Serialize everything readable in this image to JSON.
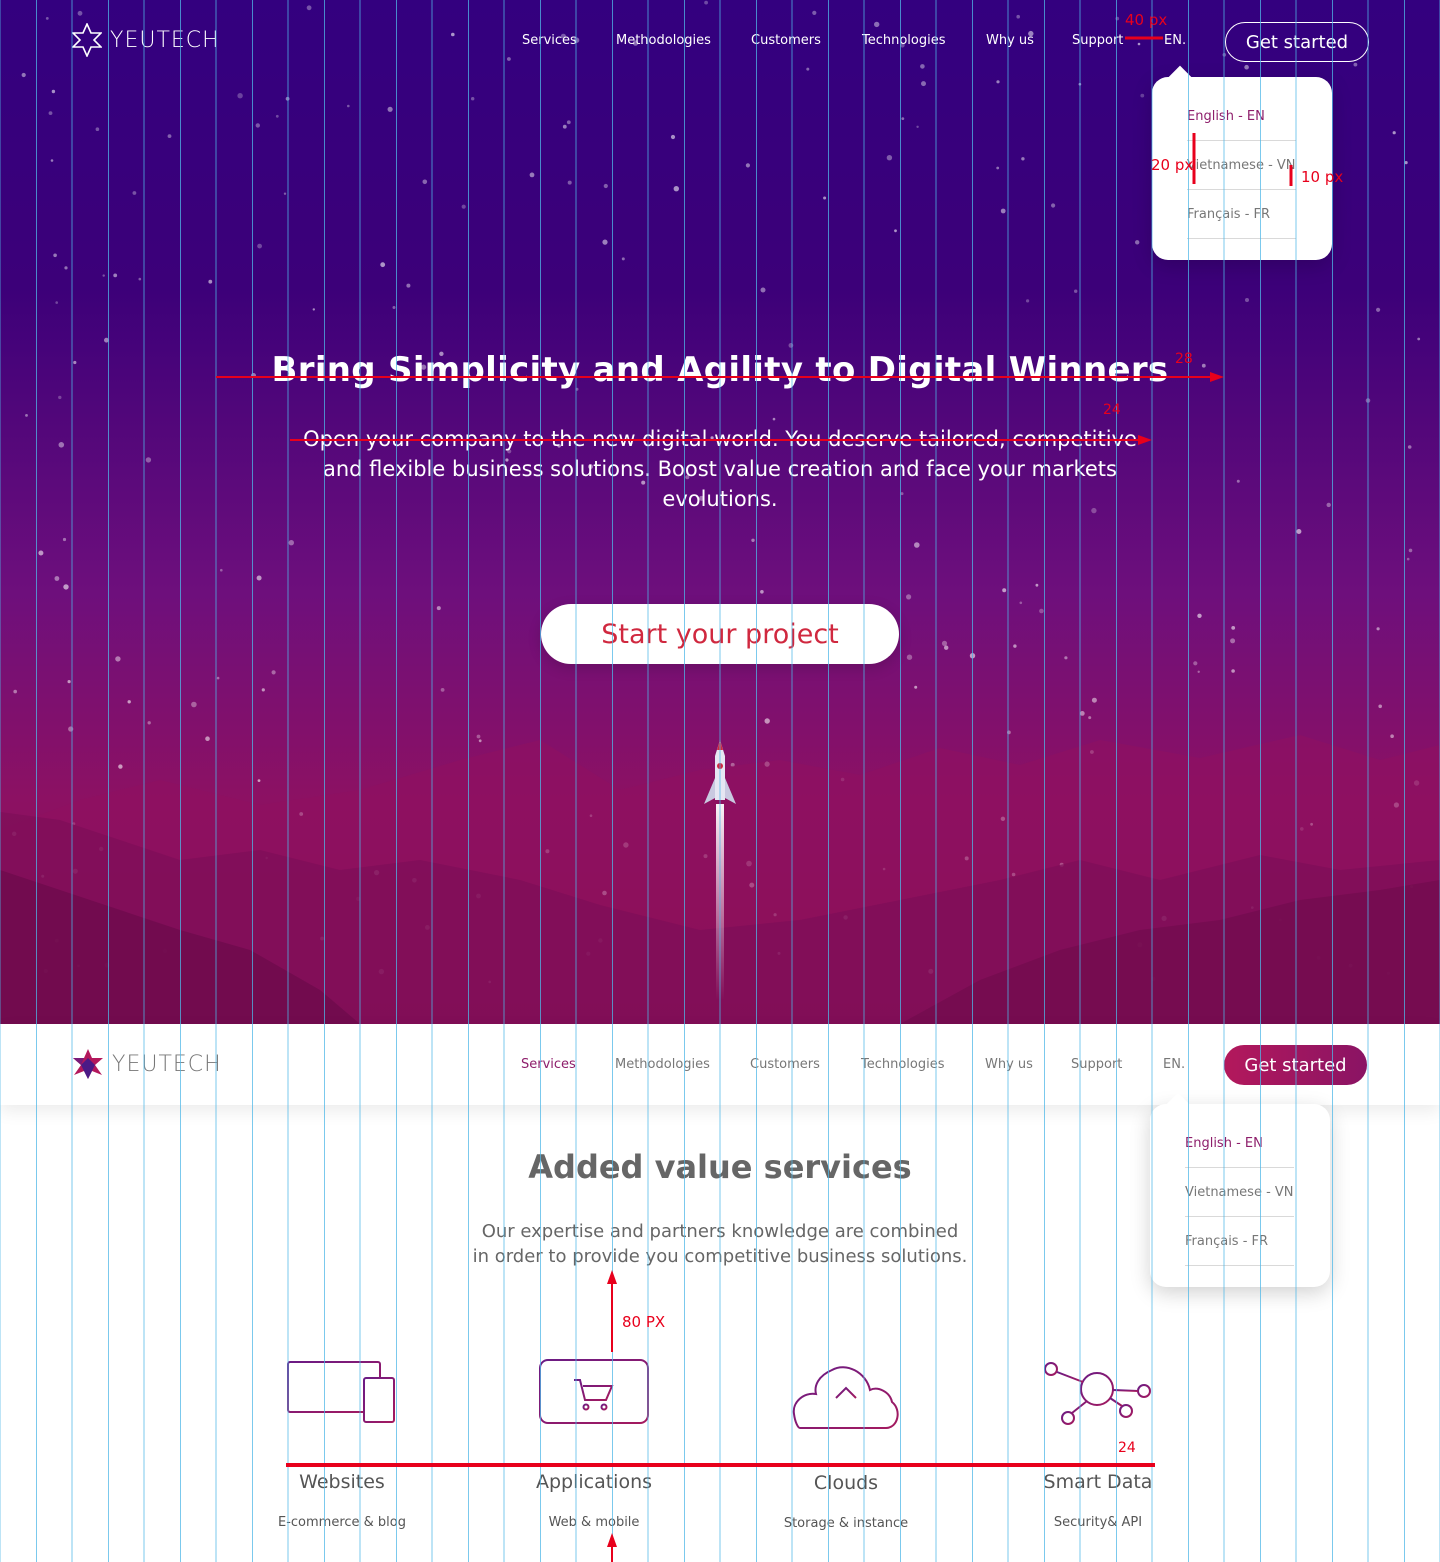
{
  "brand": {
    "name": "YEUTECH"
  },
  "colors": {
    "hero_top": "#33007f",
    "hero_bottom": "#861049",
    "accent": "#8e1e6b",
    "cta_text": "#d0283f",
    "guide": "#4fb8e8",
    "annotation": "#e8001c"
  },
  "nav": {
    "items": [
      "Services",
      "Methodologies",
      "Customers",
      "Technologies",
      "Why us",
      "Support"
    ],
    "lang": "EN.",
    "cta": "Get started"
  },
  "language_menu": {
    "options": [
      "English - EN",
      "Vietnamese - VN",
      "Français - FR"
    ],
    "selected": "English - EN"
  },
  "hero": {
    "title": "Bring Simplicity and Agility to Digital Winners",
    "subtitle": "Open your company to the new digital world. You deserve tailored, competitive and flexible business solutions. Boost value creation and face your markets evolutions.",
    "cta": "Start your project"
  },
  "sticky_header": {
    "active_item": "Services"
  },
  "services": {
    "title": "Added value services",
    "subtitle_line1": "Our expertise and partners knowledge are combined",
    "subtitle_line2": "in order to provide you competitive business solutions.",
    "items": [
      {
        "name": "Websites",
        "desc": "E-commerce & blog",
        "icon": "desktop-mobile-icon"
      },
      {
        "name": "Applications",
        "desc": "Web & mobile",
        "icon": "cart-browser-icon"
      },
      {
        "name": "Clouds",
        "desc": "Storage & instance",
        "icon": "cloud-upload-icon"
      },
      {
        "name": "Smart Data",
        "desc": "Security& API",
        "icon": "network-nodes-icon"
      }
    ]
  },
  "annotations": {
    "nav_gap": "40 px",
    "menu_left": "20 px",
    "menu_right": "10 px",
    "title_size": "28",
    "subtitle_size": "24",
    "section_gap": "80 PX",
    "service_size": "24"
  }
}
